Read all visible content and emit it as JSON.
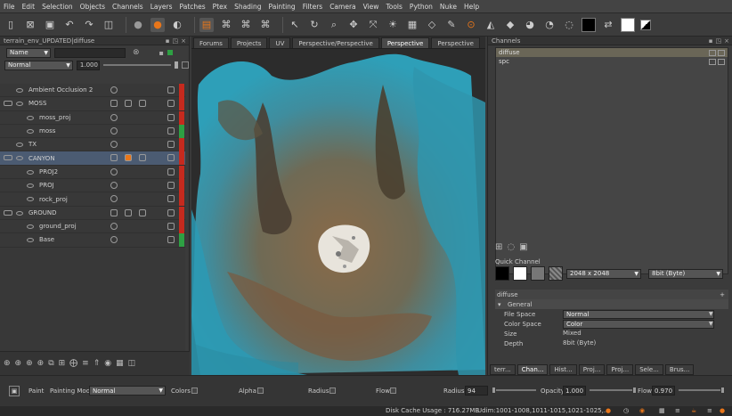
{
  "menu": [
    "File",
    "Edit",
    "Selection",
    "Objects",
    "Channels",
    "Layers",
    "Patches",
    "Ptex",
    "Shading",
    "Painting",
    "Filters",
    "Camera",
    "View",
    "Tools",
    "Python",
    "Nuke",
    "Help"
  ],
  "layers_panel": {
    "title": "terrain_env_UPDATED|diffuse",
    "search_mode": "Name",
    "blend_mode": "Normal",
    "opacity": "1.000",
    "layers": [
      {
        "name": "Ambient Occlusion 2",
        "indent": 0,
        "stripe": "#c62a1e",
        "group": false
      },
      {
        "name": "MOSS",
        "indent": 0,
        "stripe": "#c62a1e",
        "group": true
      },
      {
        "name": "moss_proj",
        "indent": 1,
        "stripe": "#c62a1e",
        "group": false
      },
      {
        "name": "moss",
        "indent": 1,
        "stripe": "#2ea043",
        "group": false
      },
      {
        "name": "TX",
        "indent": 0,
        "stripe": "#c62a1e",
        "group": false
      },
      {
        "name": "CANYON",
        "indent": 0,
        "stripe": "#c62a1e",
        "group": true,
        "selected": true
      },
      {
        "name": "PROJ2",
        "indent": 1,
        "stripe": "#c62a1e",
        "group": false
      },
      {
        "name": "PROJ",
        "indent": 1,
        "stripe": "#c62a1e",
        "group": false
      },
      {
        "name": "rock_proj",
        "indent": 1,
        "stripe": "#c62a1e",
        "group": false
      },
      {
        "name": "GROUND",
        "indent": 0,
        "stripe": "#c62a1e",
        "group": true
      },
      {
        "name": "ground_proj",
        "indent": 1,
        "stripe": "#c62a1e",
        "group": false
      },
      {
        "name": "Base",
        "indent": 1,
        "stripe": "#2ea043",
        "group": false
      }
    ]
  },
  "viewport": {
    "tabs": [
      "Forums",
      "Projects",
      "UV",
      "Perspective/Perspective",
      "Perspective",
      "Perspective"
    ],
    "active_tab": 4
  },
  "channels_panel": {
    "title": "Channels",
    "channels": [
      {
        "name": "diffuse",
        "selected": true
      },
      {
        "name": "spc",
        "selected": false
      }
    ],
    "quick_channel_label": "Quick Channel",
    "resolution": "2048 x 2048",
    "depth": "8bit (Byte)",
    "channel_name": "diffuse",
    "section": "General",
    "properties": [
      {
        "label": "File Space",
        "value": "Normal",
        "type": "select"
      },
      {
        "label": "Color Space",
        "value": "Color",
        "type": "select"
      },
      {
        "label": "Size",
        "value": "Mixed",
        "type": "text"
      },
      {
        "label": "Depth",
        "value": "8bit (Byte)",
        "type": "text"
      }
    ],
    "bottom_tabs": [
      "terr...",
      "Chan...",
      "Hist...",
      "Proj...",
      "Proj...",
      "Sele...",
      "Brus..."
    ],
    "active_bottom_tab": 1
  },
  "paint_bar": {
    "paint_label": "Paint",
    "mode_label": "Painting Mode",
    "mode_value": "Normal",
    "colors_label": "Colors",
    "alpha_label": "Alpha",
    "radius_label": "Radius",
    "flow_label": "Flow",
    "radius2_label": "Radius",
    "radius_value": "94",
    "opacity_label": "Opacity",
    "opacity_value": "1.000",
    "flow2_label": "Flow",
    "flow_value": "0.970",
    "radius_fraction": 0.03,
    "opacity_fraction": 1.0,
    "flow_fraction": 0.97
  },
  "status": {
    "disk_cache": "Disk Cache Usage : 716.27MB",
    "udim": "Udim:1001-1008,1011-1015,1021-1025,..."
  },
  "colors": {
    "accent_orange": "#e8761a",
    "selected_layer": "#4b5b72",
    "stripe_red": "#c62a1e",
    "stripe_green": "#2ea043"
  }
}
